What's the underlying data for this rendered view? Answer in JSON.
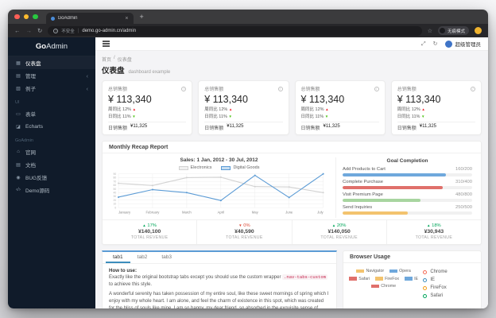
{
  "window": {
    "tab_title": "GoAdmin",
    "close_tab": "×",
    "new_tab": "+",
    "security_icon": "i",
    "security_label": "不安全",
    "url_separator": "|",
    "url": "demo.go-admin.cn/admin",
    "back": "←",
    "forward": "→",
    "reload": "↻",
    "star": "☆",
    "incognito_label": "无痕模式"
  },
  "sidebar": {
    "logo_bold": "Go",
    "logo_light": "Admin",
    "items": [
      {
        "label": "仪表盘",
        "icon": "dashboard-icon",
        "glyph": "▦",
        "active": true
      },
      {
        "label": "管理",
        "icon": "admin-icon",
        "glyph": "▤",
        "caret": "‹"
      },
      {
        "label": "例子",
        "icon": "example-icon",
        "glyph": "▧",
        "caret": "‹"
      },
      {
        "label": "UI",
        "section": true
      },
      {
        "label": "表单",
        "icon": "form-icon",
        "glyph": "▭"
      },
      {
        "label": "Echarts",
        "icon": "echarts-icon",
        "glyph": "◪"
      },
      {
        "label": "GoAdmin",
        "section": true
      },
      {
        "label": "官网",
        "icon": "home-icon",
        "glyph": "⌂"
      },
      {
        "label": "文档",
        "icon": "docs-icon",
        "glyph": "▤"
      },
      {
        "label": "BUG反馈",
        "icon": "bug-icon",
        "glyph": "◉"
      },
      {
        "label": "Demo源码",
        "icon": "code-icon",
        "glyph": "‹/›"
      }
    ]
  },
  "navbar": {
    "fullscreen_glyph": "⤢",
    "refresh_glyph": "↻",
    "user_name": "超级管理员"
  },
  "breadcrumb": {
    "home": "首页",
    "separator": "/",
    "current": "仪表盘"
  },
  "page_header": {
    "title": "仪表盘",
    "subtitle": "dashboard example"
  },
  "cards": [
    {
      "title": "总销售额",
      "info": "i",
      "value": "¥ 113,340",
      "week_label": "周同比",
      "week_value": "12%",
      "week_dir": "▲",
      "week_color": "#f5222d",
      "day_label": "日同比",
      "day_value": "11%",
      "day_dir": "▼",
      "day_color": "#52c41a",
      "footer_label": "日销售额",
      "footer_value": "¥11,325"
    },
    {
      "title": "总销售额",
      "info": "i",
      "value": "¥ 113,340",
      "week_label": "周同比",
      "week_value": "12%",
      "week_dir": "▲",
      "week_color": "#f5222d",
      "day_label": "日同比",
      "day_value": "11%",
      "day_dir": "▼",
      "day_color": "#52c41a",
      "footer_label": "日销售额",
      "footer_value": "¥11,325"
    },
    {
      "title": "总销售额",
      "info": "i",
      "value": "¥ 113,340",
      "week_label": "周同比",
      "week_value": "12%",
      "week_dir": "▲",
      "week_color": "#f5222d",
      "day_label": "日同比",
      "day_value": "11%",
      "day_dir": "▼",
      "day_color": "#52c41a",
      "footer_label": "日销售额",
      "footer_value": "¥11,325"
    },
    {
      "title": "总销售额",
      "info": "i",
      "value": "¥ 113,340",
      "week_label": "周同比",
      "week_value": "12%",
      "week_dir": "▲",
      "week_color": "#f5222d",
      "day_label": "日同比",
      "day_value": "11%",
      "day_dir": "▼",
      "day_color": "#52c41a",
      "footer_label": "日销售额",
      "footer_value": "¥11,325"
    }
  ],
  "recap": {
    "title": "Monthly Recap Report",
    "footer_stats": [
      {
        "caret": "▲",
        "pct": "17%",
        "color": "#00a65a",
        "value": "¥140,100",
        "label": "TOTAL REVENUE"
      },
      {
        "caret": "▼",
        "pct": "0%",
        "color": "#dd4b39",
        "value": "¥40,590",
        "label": "TOTAL REVENUE"
      },
      {
        "caret": "▲",
        "pct": "20%",
        "color": "#00a65a",
        "value": "¥140,050",
        "label": "TOTAL REVENUE"
      },
      {
        "caret": "▲",
        "pct": "18%",
        "color": "#00a65a",
        "value": "¥30,943",
        "label": "TOTAL REVENUE"
      }
    ]
  },
  "chart_data": {
    "type": "line",
    "title": "Sales: 1 Jan, 2012 - 30 Jul, 2012",
    "categories": [
      "January",
      "February",
      "March",
      "April",
      "May",
      "June",
      "July"
    ],
    "series": [
      {
        "name": "Electronics",
        "color": "#d2d2d2",
        "values": [
          65,
          59,
          80,
          81,
          56,
          55,
          40
        ]
      },
      {
        "name": "Digital Goods",
        "color": "#5b9bd5",
        "values": [
          28,
          48,
          40,
          19,
          86,
          27,
          90
        ]
      }
    ],
    "ylim": [
      0,
      90
    ],
    "ytick": 10,
    "grid": true,
    "legend_position": "top"
  },
  "goal": {
    "title": "Goal Completion",
    "items": [
      {
        "label": "Add Products to Cart",
        "value": "160/200",
        "pct": 80,
        "color": "#6fa8dc"
      },
      {
        "label": "Complete Purchase",
        "value": "310/400",
        "pct": 77.5,
        "color": "#e0706b"
      },
      {
        "label": "Visit Premium Page",
        "value": "480/800",
        "pct": 60,
        "color": "#a8d5a0"
      },
      {
        "label": "Send Inquiries",
        "value": "250/500",
        "pct": 50,
        "color": "#f3c36e"
      }
    ]
  },
  "tabs_panel": {
    "tabs": [
      {
        "label": "tab1",
        "active": true
      },
      {
        "label": "tab2"
      },
      {
        "label": "tab3"
      }
    ],
    "how_title": "How to use:",
    "how_text_pre": "Exactly like the original bootstrap tabs except you should use the custom wrapper ",
    "how_code": ".nav-tabs-custom",
    "how_text_post": " to achieve this style.",
    "body_text": "A wonderful serenity has taken possession of my entire soul, like these sweet mornings of spring which I enjoy with my whole heart. I am alone, and feel the charm of existence in this spot, which was created for the bliss of souls like mine. I am so happy, my dear friend, so absorbed in the exquisite sense of mere tranquil existence, that I neglect my talents."
  },
  "browser_usage": {
    "title": "Browser Usage",
    "legend": [
      {
        "label": "Navigator",
        "color": "#f3c36e"
      },
      {
        "label": "Opera",
        "color": "#6fa8dc"
      },
      {
        "label": "Safari",
        "color": "#e0706b"
      },
      {
        "label": "FireFox",
        "color": "#f3c36e"
      },
      {
        "label": "IE",
        "color": "#6fa8dc"
      },
      {
        "label": "Chrome",
        "color": "#e0706b"
      }
    ],
    "list": [
      {
        "label": "Chrome",
        "color": "#f56954"
      },
      {
        "label": "IE",
        "color": "#3c8dbc"
      },
      {
        "label": "FireFox",
        "color": "#f39c12"
      },
      {
        "label": "Safari",
        "color": "#00a65a"
      }
    ]
  }
}
